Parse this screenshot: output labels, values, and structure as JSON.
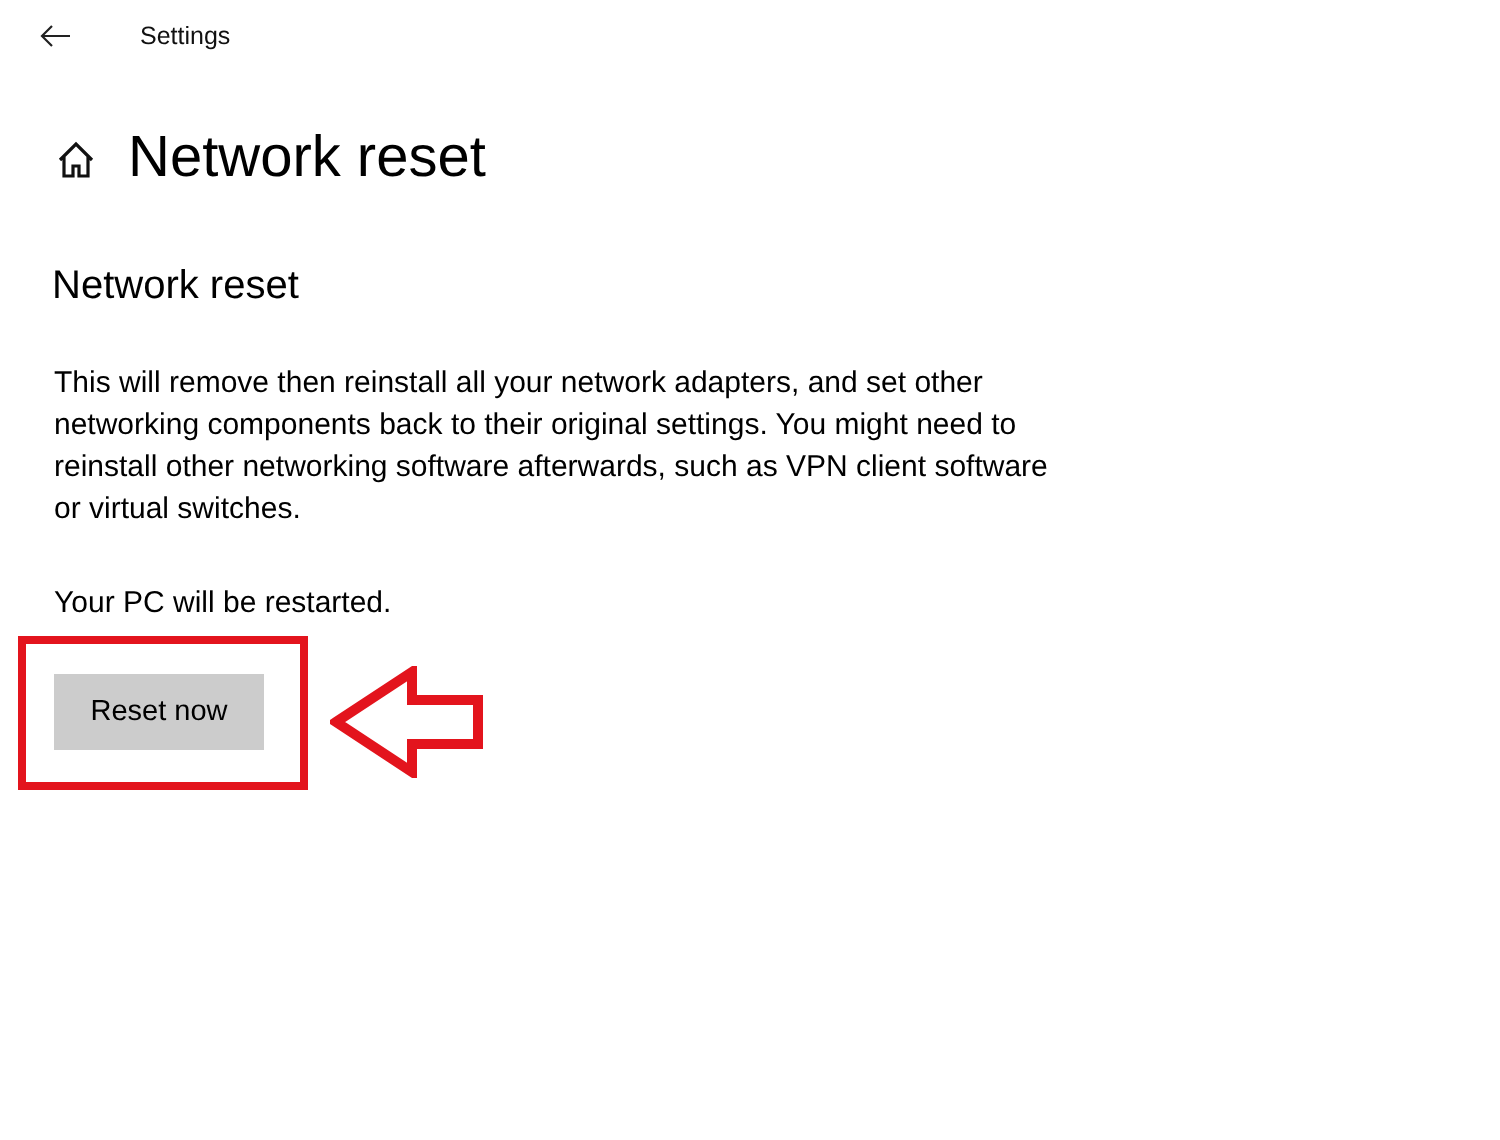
{
  "window": {
    "title": "Settings"
  },
  "page": {
    "title": "Network reset"
  },
  "section": {
    "heading": "Network reset",
    "description": "This will remove then reinstall all your network adapters, and set other networking components back to their original settings. You might need to reinstall other networking software afterwards, such as VPN client software or virtual switches.",
    "note": "Your PC will be restarted.",
    "button": "Reset now"
  }
}
